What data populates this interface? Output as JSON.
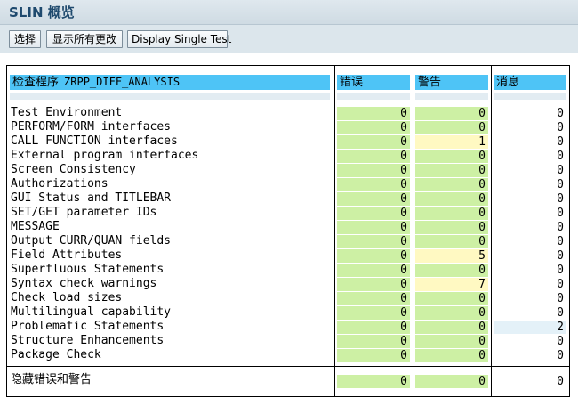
{
  "window": {
    "title": "SLIN 概览"
  },
  "toolbar": {
    "buttons": [
      {
        "label": "选择"
      },
      {
        "label": "显示所有更改"
      },
      {
        "label": "Display Single Test"
      }
    ]
  },
  "table": {
    "header": {
      "prefix": "检查程序",
      "program": "ZRPP_DIFF_ANALYSIS",
      "col_errors": "错误",
      "col_warnings": "警告",
      "col_messages": "消息"
    },
    "rows": [
      {
        "label": "Test Environment",
        "errors": "0",
        "warnings": "0",
        "messages": "0",
        "wstate": "g",
        "mstate": "w"
      },
      {
        "label": "PERFORM/FORM interfaces",
        "errors": "0",
        "warnings": "0",
        "messages": "0",
        "wstate": "g",
        "mstate": "w"
      },
      {
        "label": "CALL FUNCTION interfaces",
        "errors": "0",
        "warnings": "1",
        "messages": "0",
        "wstate": "y",
        "mstate": "w"
      },
      {
        "label": "External program interfaces",
        "errors": "0",
        "warnings": "0",
        "messages": "0",
        "wstate": "g",
        "mstate": "w"
      },
      {
        "label": "Screen Consistency",
        "errors": "0",
        "warnings": "0",
        "messages": "0",
        "wstate": "g",
        "mstate": "w"
      },
      {
        "label": "Authorizations",
        "errors": "0",
        "warnings": "0",
        "messages": "0",
        "wstate": "g",
        "mstate": "w"
      },
      {
        "label": "GUI Status and TITLEBAR",
        "errors": "0",
        "warnings": "0",
        "messages": "0",
        "wstate": "g",
        "mstate": "w"
      },
      {
        "label": "SET/GET parameter IDs",
        "errors": "0",
        "warnings": "0",
        "messages": "0",
        "wstate": "g",
        "mstate": "w"
      },
      {
        "label": "MESSAGE",
        "errors": "0",
        "warnings": "0",
        "messages": "0",
        "wstate": "g",
        "mstate": "w"
      },
      {
        "label": "Output CURR/QUAN fields",
        "errors": "0",
        "warnings": "0",
        "messages": "0",
        "wstate": "g",
        "mstate": "w"
      },
      {
        "label": "Field Attributes",
        "errors": "0",
        "warnings": "5",
        "messages": "0",
        "wstate": "y",
        "mstate": "w"
      },
      {
        "label": "Superfluous Statements",
        "errors": "0",
        "warnings": "0",
        "messages": "0",
        "wstate": "g",
        "mstate": "w"
      },
      {
        "label": "Syntax check warnings",
        "errors": "0",
        "warnings": "7",
        "messages": "0",
        "wstate": "y",
        "mstate": "w"
      },
      {
        "label": "Check load sizes",
        "errors": "0",
        "warnings": "0",
        "messages": "0",
        "wstate": "g",
        "mstate": "w"
      },
      {
        "label": "Multilingual capability",
        "errors": "0",
        "warnings": "0",
        "messages": "0",
        "wstate": "g",
        "mstate": "w"
      },
      {
        "label": "Problematic Statements",
        "errors": "0",
        "warnings": "0",
        "messages": "2",
        "wstate": "g",
        "mstate": "b"
      },
      {
        "label": "Structure Enhancements",
        "errors": "0",
        "warnings": "0",
        "messages": "0",
        "wstate": "g",
        "mstate": "w"
      },
      {
        "label": "Package Check",
        "errors": "0",
        "warnings": "0",
        "messages": "0",
        "wstate": "g",
        "mstate": "w"
      }
    ],
    "summary": {
      "label": "隐藏错误和警告",
      "errors": "0",
      "warnings": "0",
      "messages": "0"
    }
  },
  "colors": {
    "header_bg": "#4ec4f6",
    "ok_cell": "#cdf0a4",
    "warning_cell": "#fff9c2",
    "info_cell": "#e4f1f8",
    "title_text": "#1f4a6e"
  }
}
